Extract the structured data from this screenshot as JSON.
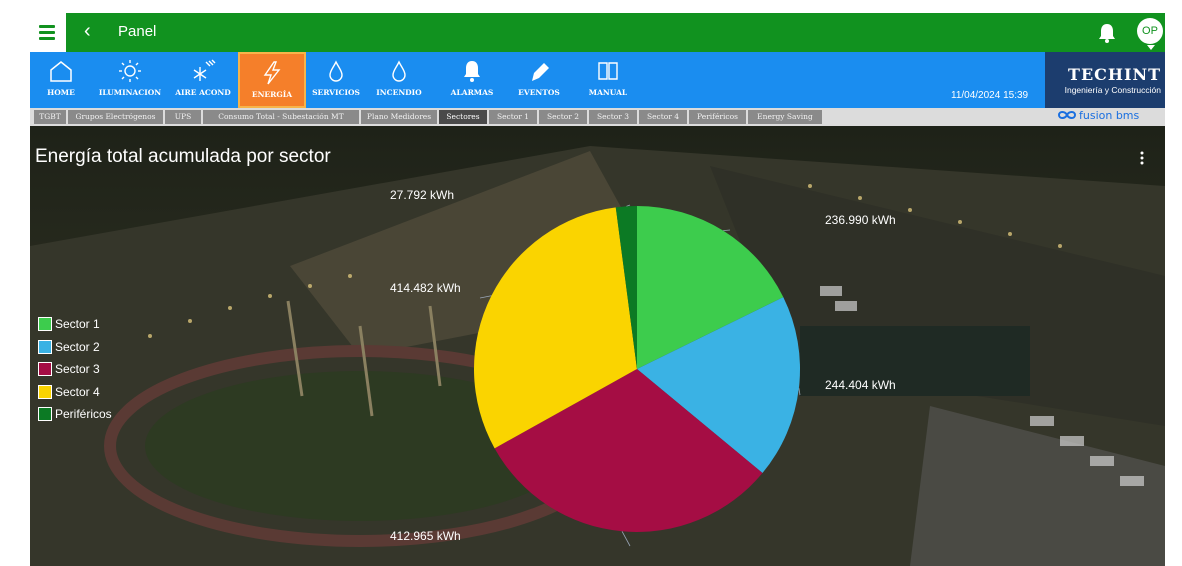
{
  "header": {
    "title": "Panel",
    "avatar": "OP"
  },
  "nav": [
    {
      "label": "HOME",
      "icon": "home-icon"
    },
    {
      "label": "ILUMINACION",
      "icon": "sun-icon"
    },
    {
      "label": "AIRE ACOND",
      "icon": "snowflake-icon"
    },
    {
      "label": "ENERGÍA",
      "icon": "lightning-icon",
      "active": true
    },
    {
      "label": "SERVICIOS",
      "icon": "water-drop-icon"
    },
    {
      "label": "INCENDIO",
      "icon": "water-drop-icon"
    },
    {
      "label": "ALARMAS",
      "icon": "bell-icon"
    },
    {
      "label": "EVENTOS",
      "icon": "pencil-icon"
    },
    {
      "label": "MANUAL",
      "icon": "book-icon"
    }
  ],
  "datetime": "11/04/2024 15:39",
  "brand": {
    "name": "TECHINT",
    "sub": "Ingeniería y Construcción"
  },
  "tabs": [
    {
      "label": "TGBT"
    },
    {
      "label": "Grupos Electrógenos"
    },
    {
      "label": "UPS"
    },
    {
      "label": "Consumo Total - Subestación MT"
    },
    {
      "label": "Plano Medidores"
    },
    {
      "label": "Sectores",
      "active": true
    },
    {
      "label": "Sector 1"
    },
    {
      "label": "Sector 2"
    },
    {
      "label": "Sector 3"
    },
    {
      "label": "Sector 4"
    },
    {
      "label": "Periféricos"
    },
    {
      "label": "Energy Saving"
    }
  ],
  "fusion": "fusion bms",
  "colors": {
    "green_bar": "#11921f",
    "nav_blue": "#1a8df0",
    "active_orange": "#f57f2a",
    "brand_navy": "#1c3d6e"
  },
  "chart_data": {
    "type": "pie",
    "title": "Energía total acumulada por sector",
    "unit": "kWh",
    "legend_position": "left",
    "series": [
      {
        "name": "Sector 1",
        "value": 236990,
        "label": "236.990 kWh",
        "color": "#3dcc4d"
      },
      {
        "name": "Sector 2",
        "value": 244404,
        "label": "244.404 kWh",
        "color": "#3ab2e4"
      },
      {
        "name": "Sector 3",
        "value": 412965,
        "label": "412.965 kWh",
        "color": "#a50d44"
      },
      {
        "name": "Sector 4",
        "value": 414482,
        "label": "414.482 kWh",
        "color": "#fad400"
      },
      {
        "name": "Periféricos",
        "value": 27792,
        "label": "27.792 kWh",
        "color": "#0c7a24"
      }
    ]
  }
}
